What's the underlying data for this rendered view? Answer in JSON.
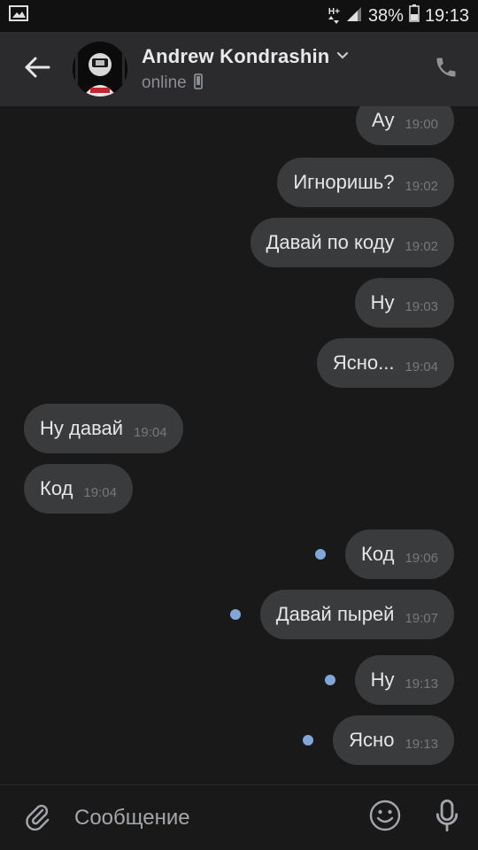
{
  "status_bar": {
    "network_label": "H+",
    "battery": "38%",
    "time": "19:13",
    "icons": [
      "gallery-icon",
      "network-icon",
      "signal-icon",
      "battery-icon"
    ]
  },
  "header": {
    "contact_name": "Andrew Kondrashin",
    "presence": "online",
    "icons": [
      "back-arrow-icon",
      "chevron-down-icon",
      "mobile-phone-icon",
      "phone-icon"
    ]
  },
  "messages": [
    {
      "text": "Ау",
      "time": "19:00",
      "direction": "outgoing",
      "unread": false
    },
    {
      "text": "Игноришь?",
      "time": "19:02",
      "direction": "outgoing",
      "unread": false
    },
    {
      "text": "Давай по коду",
      "time": "19:02",
      "direction": "outgoing",
      "unread": false
    },
    {
      "text": "Ну",
      "time": "19:03",
      "direction": "outgoing",
      "unread": false
    },
    {
      "text": "Ясно...",
      "time": "19:04",
      "direction": "outgoing",
      "unread": false
    },
    {
      "text": "Ну давай",
      "time": "19:04",
      "direction": "incoming",
      "unread": false
    },
    {
      "text": "Код",
      "time": "19:04",
      "direction": "incoming",
      "unread": false
    },
    {
      "text": "Код",
      "time": "19:06",
      "direction": "outgoing",
      "unread": true
    },
    {
      "text": "Давай пырей",
      "time": "19:07",
      "direction": "outgoing",
      "unread": true
    },
    {
      "text": "Ну",
      "time": "19:13",
      "direction": "outgoing",
      "unread": true
    },
    {
      "text": "Ясно",
      "time": "19:13",
      "direction": "outgoing",
      "unread": true
    }
  ],
  "composer": {
    "placeholder": "Сообщение",
    "icons": [
      "paperclip-icon",
      "emoji-icon",
      "microphone-icon"
    ]
  },
  "colors": {
    "background": "#19191a",
    "header": "#2b2b2d",
    "bubble": "#3a3b3c",
    "unread_dot": "#7fa8d8",
    "timestamp": "#76787b"
  }
}
